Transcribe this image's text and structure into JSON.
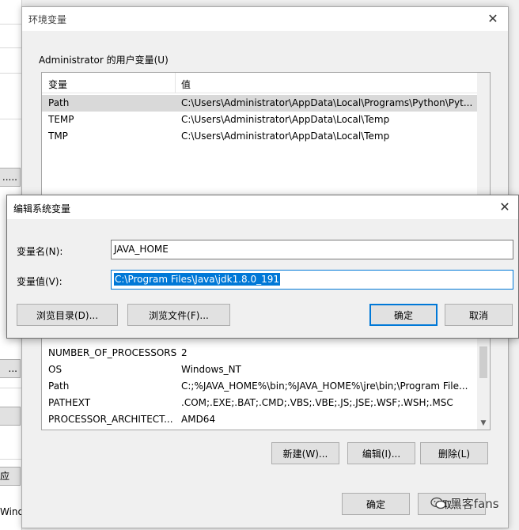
{
  "background_window": {
    "fragment_texts": [
      ".....",
      "...",
      "应用(",
      "Windo"
    ]
  },
  "env_window": {
    "title": "环境变量",
    "close_glyph": "✕",
    "user_vars": {
      "group_title": "Administrator 的用户变量(U)",
      "columns": [
        "变量",
        "值"
      ],
      "rows": [
        {
          "name": "Path",
          "value": "C:\\Users\\Administrator\\AppData\\Local\\Programs\\Python\\Pyt..."
        },
        {
          "name": "TEMP",
          "value": "C:\\Users\\Administrator\\AppData\\Local\\Temp"
        },
        {
          "name": "TMP",
          "value": "C:\\Users\\Administrator\\AppData\\Local\\Temp"
        }
      ]
    },
    "system_vars": {
      "rows": [
        {
          "name": "NUMBER_OF_PROCESSORS",
          "value": "2"
        },
        {
          "name": "OS",
          "value": "Windows_NT"
        },
        {
          "name": "Path",
          "value": "C:;%JAVA_HOME%\\bin;%JAVA_HOME%\\jre\\bin;\\Program File..."
        },
        {
          "name": "PATHEXT",
          "value": ".COM;.EXE;.BAT;.CMD;.VBS;.VBE;.JS;.JSE;.WSF;.WSH;.MSC"
        },
        {
          "name": "PROCESSOR_ARCHITECT...",
          "value": "AMD64"
        }
      ],
      "new_button": "新建(W)...",
      "edit_button": "编辑(I)...",
      "delete_button": "删除(L)"
    },
    "ok_button": "确定",
    "cancel_button": "取消"
  },
  "edit_dialog": {
    "title": "编辑系统变量",
    "close_glyph": "✕",
    "name_label": "变量名(N):",
    "name_value": "JAVA_HOME",
    "value_label": "变量值(V):",
    "value_value": "C:\\Program Files\\Java\\jdk1.8.0_191",
    "browse_dir_button": "浏览目录(D)...",
    "browse_file_button": "浏览文件(F)...",
    "ok_button": "确定",
    "cancel_button": "取消"
  },
  "watermark": {
    "text": "黑客fans"
  },
  "colors": {
    "accent": "#0078d7",
    "selected_row": "#d9d9d9",
    "button_face": "#e1e1e1"
  }
}
